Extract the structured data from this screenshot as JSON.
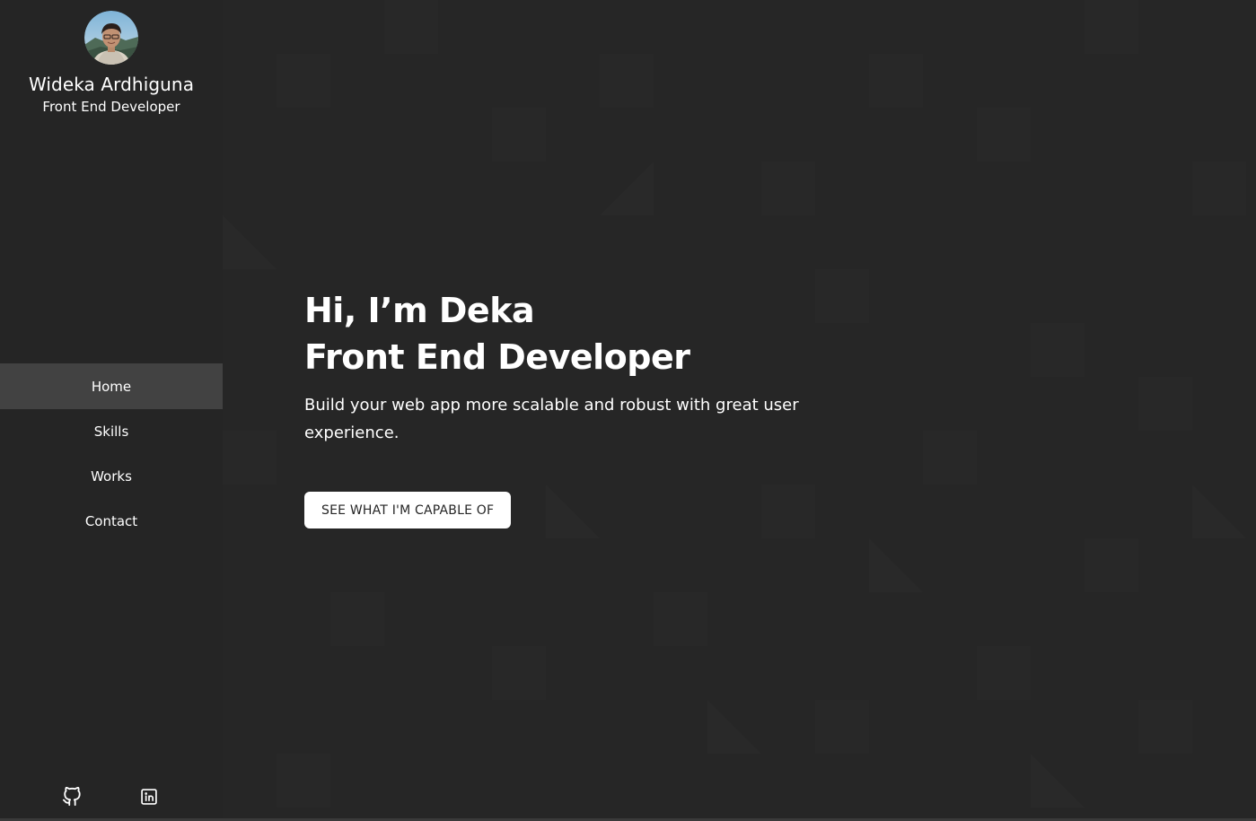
{
  "profile": {
    "name": "Wideka Ardhiguna",
    "role": "Front End Developer"
  },
  "nav": {
    "items": [
      {
        "label": "Home",
        "active": true
      },
      {
        "label": "Skills",
        "active": false
      },
      {
        "label": "Works",
        "active": false
      },
      {
        "label": "Contact",
        "active": false
      }
    ]
  },
  "socials": {
    "github_icon": "github-icon",
    "linkedin_icon": "linkedin-icon"
  },
  "hero": {
    "title_line1": "Hi, I’m Deka",
    "title_line2": "Front End Developer",
    "description": "Build your web app more scalable and robust with great user experience.",
    "cta_label": "SEE WHAT I'M CAPABLE OF"
  },
  "colors": {
    "background": "#262626",
    "sidebar": "#252525",
    "nav_active": "#424242",
    "text": "#ffffff",
    "button_bg": "#ffffff",
    "button_text": "#262626"
  }
}
